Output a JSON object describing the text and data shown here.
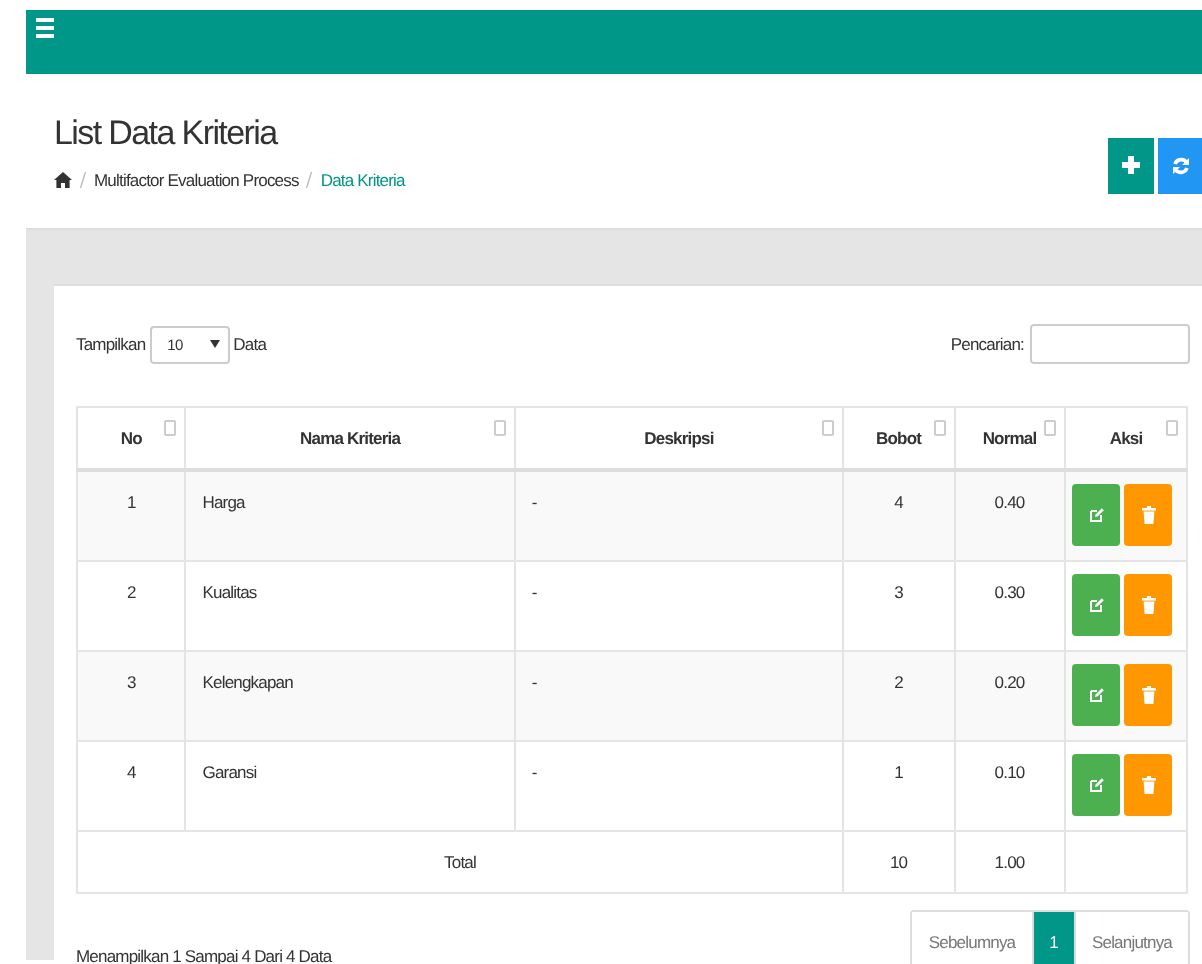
{
  "page": {
    "title": "List Data Kriteria",
    "breadcrumb": [
      {
        "label": "Multifactor Evaluation Process",
        "current": false
      },
      {
        "label": "Data Kriteria",
        "current": true
      }
    ]
  },
  "controls": {
    "show_label": "Tampilkan",
    "show_value": "10",
    "show_suffix": "Data",
    "search_label": "Pencarian:"
  },
  "table": {
    "columns": [
      "No",
      "Nama Kriteria",
      "Deskripsi",
      "Bobot",
      "Normal",
      "Aksi"
    ],
    "rows": [
      {
        "no": "1",
        "name": "Harga",
        "description": "-",
        "bobot": "4",
        "normal": "0.40"
      },
      {
        "no": "2",
        "name": "Kualitas",
        "description": "-",
        "bobot": "3",
        "normal": "0.30"
      },
      {
        "no": "3",
        "name": "Kelengkapan",
        "description": "-",
        "bobot": "2",
        "normal": "0.20"
      },
      {
        "no": "4",
        "name": "Garansi",
        "description": "-",
        "bobot": "1",
        "normal": "0.10"
      }
    ],
    "total": {
      "label": "Total",
      "bobot": "10",
      "normal": "1.00"
    }
  },
  "footer": {
    "info": "Menampilkan 1 Sampai 4 Dari 4 Data",
    "pages": [
      {
        "label": "Sebelumnya",
        "selected": false
      },
      {
        "label": "1",
        "selected": true
      },
      {
        "label": "Selanjutnya",
        "selected": false
      }
    ]
  }
}
